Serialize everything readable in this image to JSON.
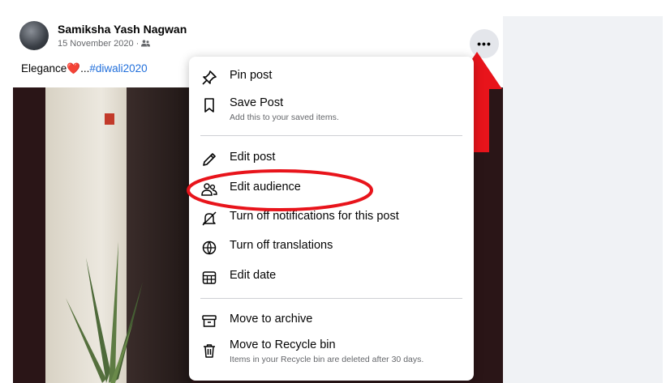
{
  "post": {
    "author": "Samiksha Yash Nagwan",
    "date": "15 November 2020",
    "meta_separator": " · ",
    "audience_icon": "friends-icon",
    "caption_text": "Elegance",
    "caption_emoji": "❤️",
    "caption_ellipsis": "...",
    "caption_hashtag": "#diwali2020",
    "more_label": "•••"
  },
  "menu": {
    "items": [
      {
        "label": "Pin post",
        "icon": "pin-icon"
      },
      {
        "label": "Save Post",
        "sub": "Add this to your saved items.",
        "icon": "bookmark-icon"
      },
      {
        "label": "Edit post",
        "icon": "pencil-icon"
      },
      {
        "label": "Edit audience",
        "icon": "people-icon"
      },
      {
        "label": "Turn off notifications for this post",
        "icon": "bell-off-icon"
      },
      {
        "label": "Turn off translations",
        "icon": "globe-icon"
      },
      {
        "label": "Edit date",
        "icon": "calendar-icon"
      },
      {
        "label": "Move to archive",
        "icon": "archive-icon"
      },
      {
        "label": "Move to Recycle bin",
        "sub": "Items in your Recycle bin are deleted after 30 days.",
        "icon": "trash-icon"
      }
    ]
  },
  "annotations": {
    "arrow_color": "#e8141b",
    "ellipse_color": "#e8141b"
  }
}
